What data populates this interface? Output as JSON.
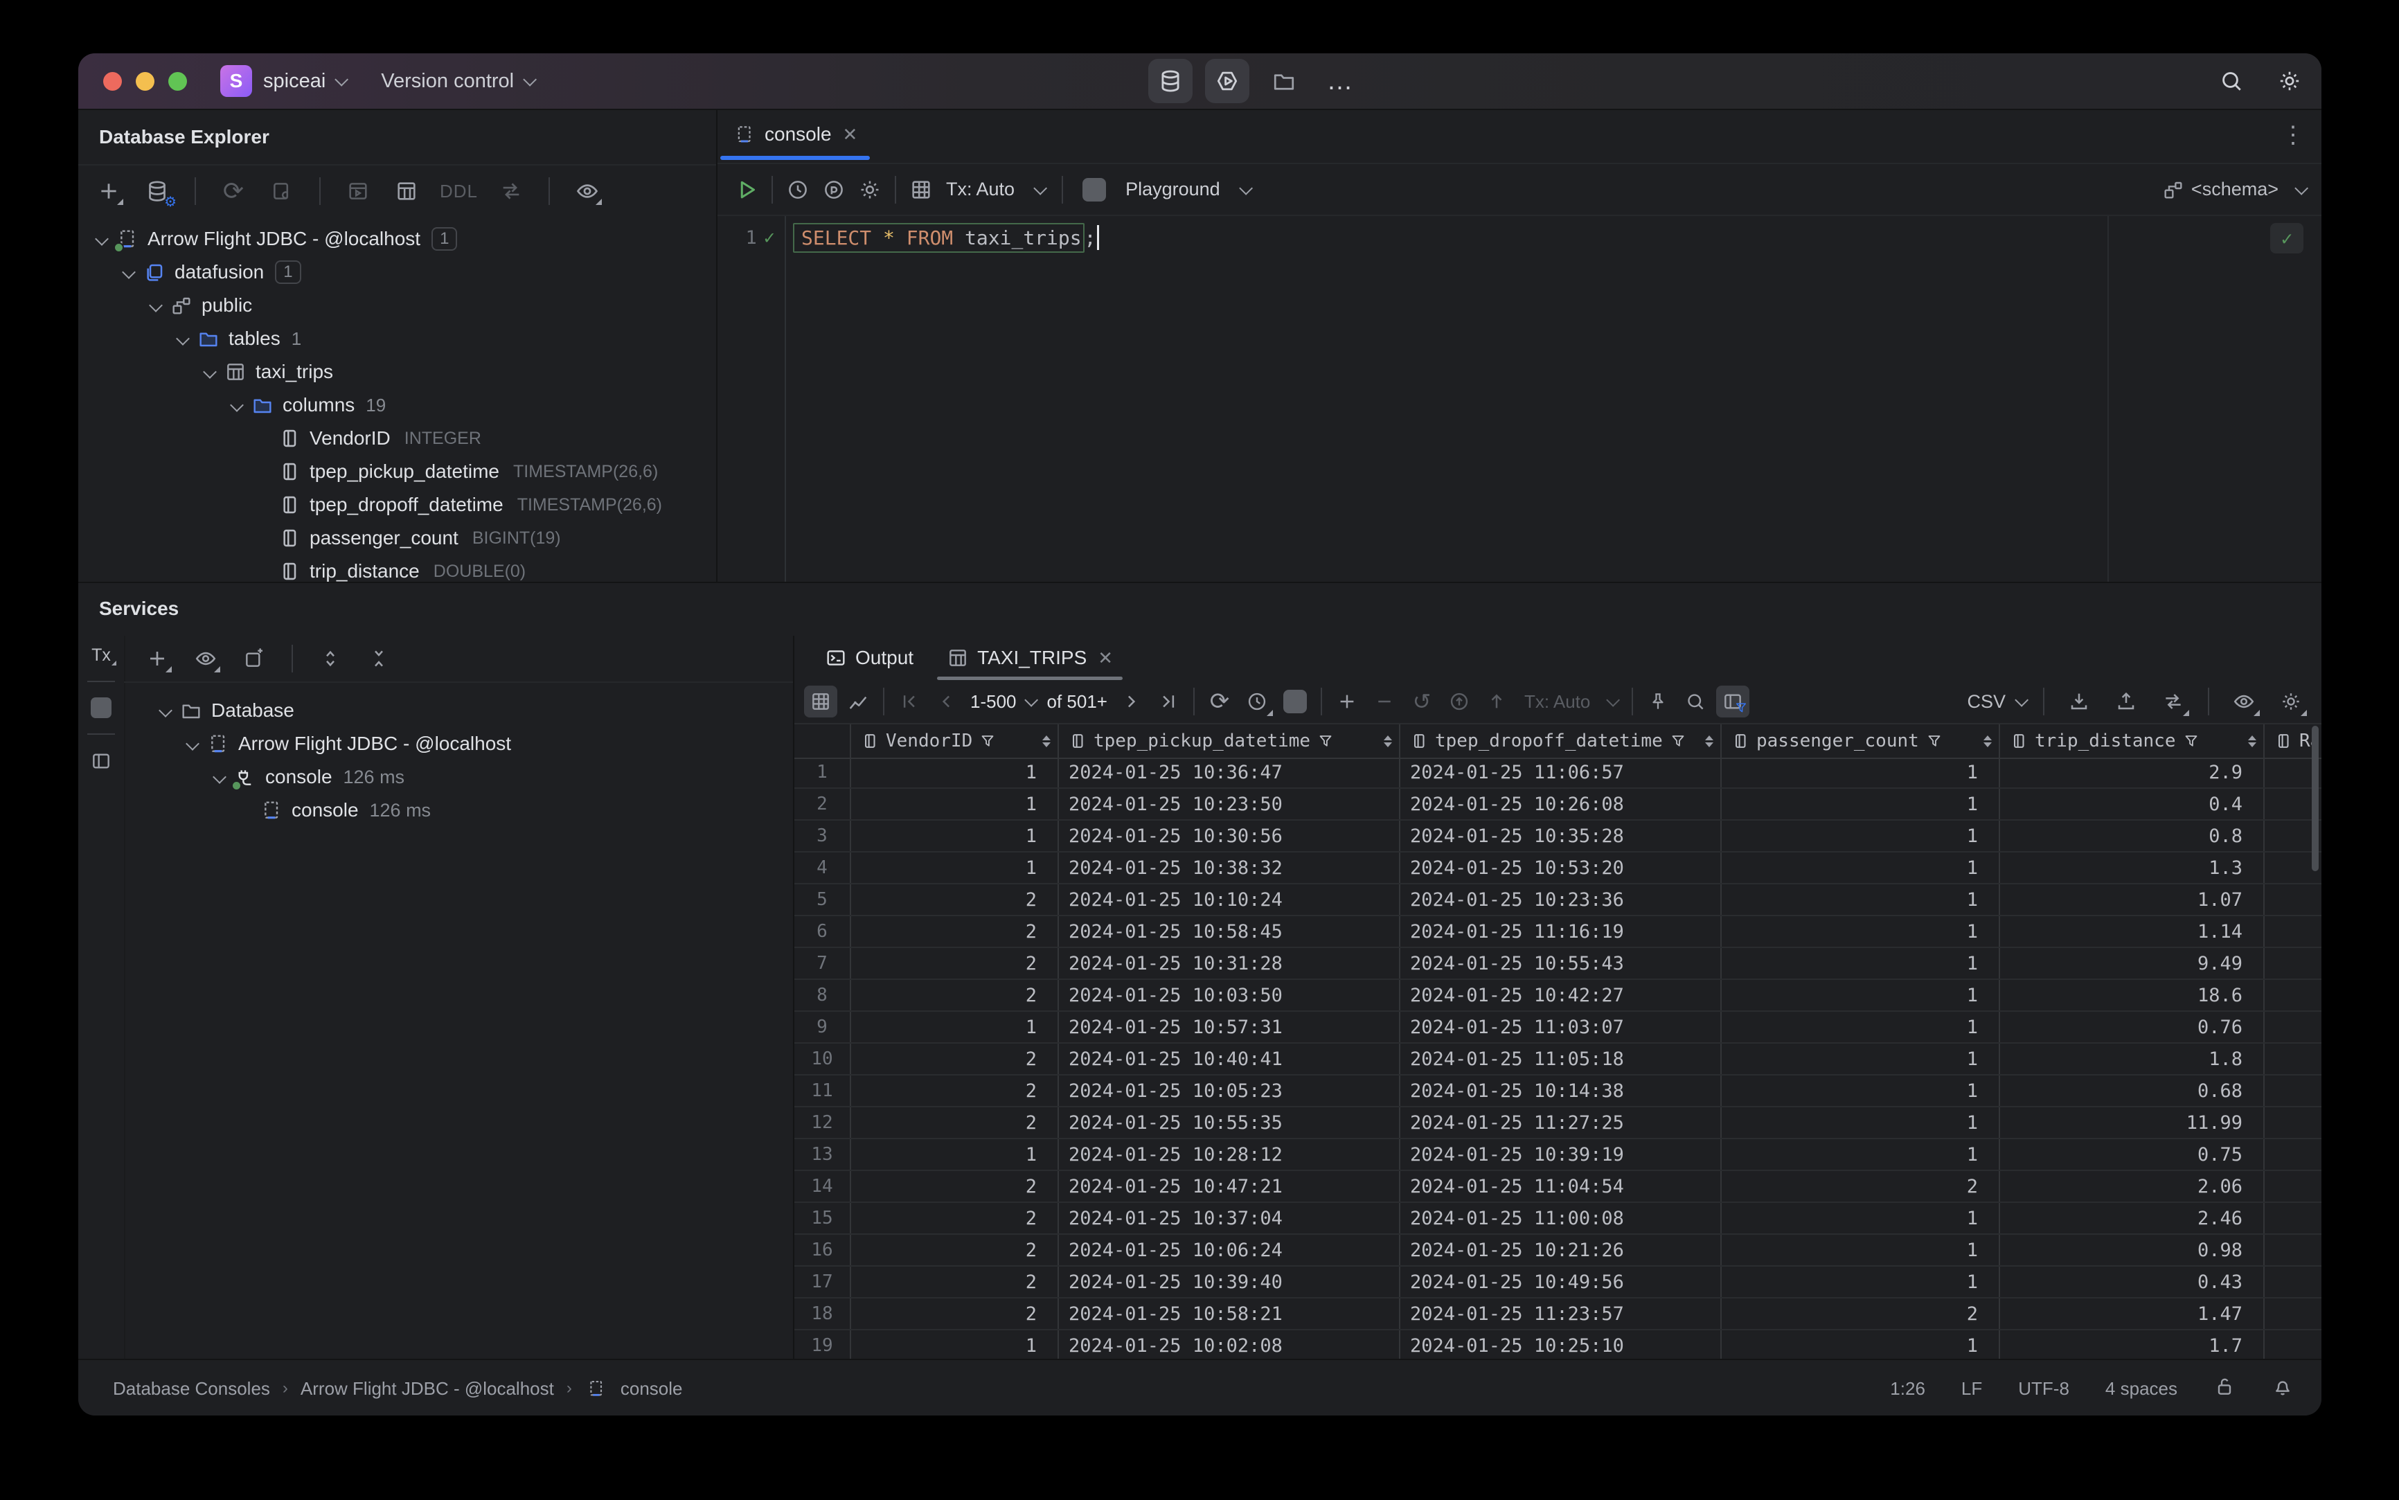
{
  "titlebar": {
    "project_initial": "S",
    "project_name": "spiceai",
    "menu_version_control": "Version control"
  },
  "database_explorer": {
    "title": "Database Explorer",
    "toolbar_ddl_label": "DDL",
    "tree": [
      {
        "label": "Arrow Flight JDBC - @localhost",
        "badge": "1"
      },
      {
        "label": "datafusion",
        "badge": "1"
      },
      {
        "label": "public"
      },
      {
        "label": "tables",
        "count": "1"
      },
      {
        "label": "taxi_trips"
      },
      {
        "label": "columns",
        "count": "19"
      },
      {
        "label": "VendorID",
        "type": "INTEGER"
      },
      {
        "label": "tpep_pickup_datetime",
        "type": "TIMESTAMP(26,6)"
      },
      {
        "label": "tpep_dropoff_datetime",
        "type": "TIMESTAMP(26,6)"
      },
      {
        "label": "passenger_count",
        "type": "BIGINT(19)"
      },
      {
        "label": "trip_distance",
        "type": "DOUBLE(0)"
      }
    ]
  },
  "editor": {
    "tab_label": "console",
    "toolbar": {
      "tx_mode": "Tx: Auto",
      "profile": "Playground",
      "schema": "<schema>"
    },
    "line_number": "1",
    "sql": {
      "kw_select": "SELECT",
      "star": "*",
      "kw_from": "FROM",
      "identifier": "taxi_trips",
      "semicolon": ";"
    }
  },
  "services": {
    "title": "Services",
    "strip_tx_label": "Tx",
    "tree": [
      {
        "label": "Database"
      },
      {
        "label": "Arrow Flight JDBC - @localhost"
      },
      {
        "label": "console",
        "duration": "126 ms"
      },
      {
        "label": "console",
        "duration": "126 ms"
      }
    ]
  },
  "results": {
    "output_tab": "Output",
    "grid_tab": "TAXI_TRIPS",
    "toolbar": {
      "page_range": "1-500",
      "page_total": "of 501+",
      "tx_mode": "Tx: Auto",
      "export_format": "CSV"
    },
    "table": {
      "columns": [
        "VendorID",
        "tpep_pickup_datetime",
        "tpep_dropoff_datetime",
        "passenger_count",
        "trip_distance",
        "Rate"
      ],
      "rows": [
        [
          "1",
          "1",
          "2024-01-25 10:36:47",
          "2024-01-25 11:06:57",
          "1",
          "2.9"
        ],
        [
          "2",
          "1",
          "2024-01-25 10:23:50",
          "2024-01-25 10:26:08",
          "1",
          "0.4"
        ],
        [
          "3",
          "1",
          "2024-01-25 10:30:56",
          "2024-01-25 10:35:28",
          "1",
          "0.8"
        ],
        [
          "4",
          "1",
          "2024-01-25 10:38:32",
          "2024-01-25 10:53:20",
          "1",
          "1.3"
        ],
        [
          "5",
          "2",
          "2024-01-25 10:10:24",
          "2024-01-25 10:23:36",
          "1",
          "1.07"
        ],
        [
          "6",
          "2",
          "2024-01-25 10:58:45",
          "2024-01-25 11:16:19",
          "1",
          "1.14"
        ],
        [
          "7",
          "2",
          "2024-01-25 10:31:28",
          "2024-01-25 10:55:43",
          "1",
          "9.49"
        ],
        [
          "8",
          "2",
          "2024-01-25 10:03:50",
          "2024-01-25 10:42:27",
          "1",
          "18.6"
        ],
        [
          "9",
          "1",
          "2024-01-25 10:57:31",
          "2024-01-25 11:03:07",
          "1",
          "0.76"
        ],
        [
          "10",
          "2",
          "2024-01-25 10:40:41",
          "2024-01-25 11:05:18",
          "1",
          "1.8"
        ],
        [
          "11",
          "2",
          "2024-01-25 10:05:23",
          "2024-01-25 10:14:38",
          "1",
          "0.68"
        ],
        [
          "12",
          "2",
          "2024-01-25 10:55:35",
          "2024-01-25 11:27:25",
          "1",
          "11.99"
        ],
        [
          "13",
          "1",
          "2024-01-25 10:28:12",
          "2024-01-25 10:39:19",
          "1",
          "0.75"
        ],
        [
          "14",
          "2",
          "2024-01-25 10:47:21",
          "2024-01-25 11:04:54",
          "2",
          "2.06"
        ],
        [
          "15",
          "2",
          "2024-01-25 10:37:04",
          "2024-01-25 11:00:08",
          "1",
          "2.46"
        ],
        [
          "16",
          "2",
          "2024-01-25 10:06:24",
          "2024-01-25 10:21:26",
          "1",
          "0.98"
        ],
        [
          "17",
          "2",
          "2024-01-25 10:39:40",
          "2024-01-25 10:49:56",
          "1",
          "0.43"
        ],
        [
          "18",
          "2",
          "2024-01-25 10:58:21",
          "2024-01-25 11:23:57",
          "2",
          "1.47"
        ],
        [
          "19",
          "1",
          "2024-01-25 10:02:08",
          "2024-01-25 10:25:10",
          "1",
          "1.7"
        ]
      ]
    }
  },
  "status_bar": {
    "breadcrumbs": [
      "Database Consoles",
      "Arrow Flight JDBC - @localhost",
      "console"
    ],
    "caret_position": "1:26",
    "line_separator": "LF",
    "encoding": "UTF-8",
    "indent": "4 spaces"
  }
}
